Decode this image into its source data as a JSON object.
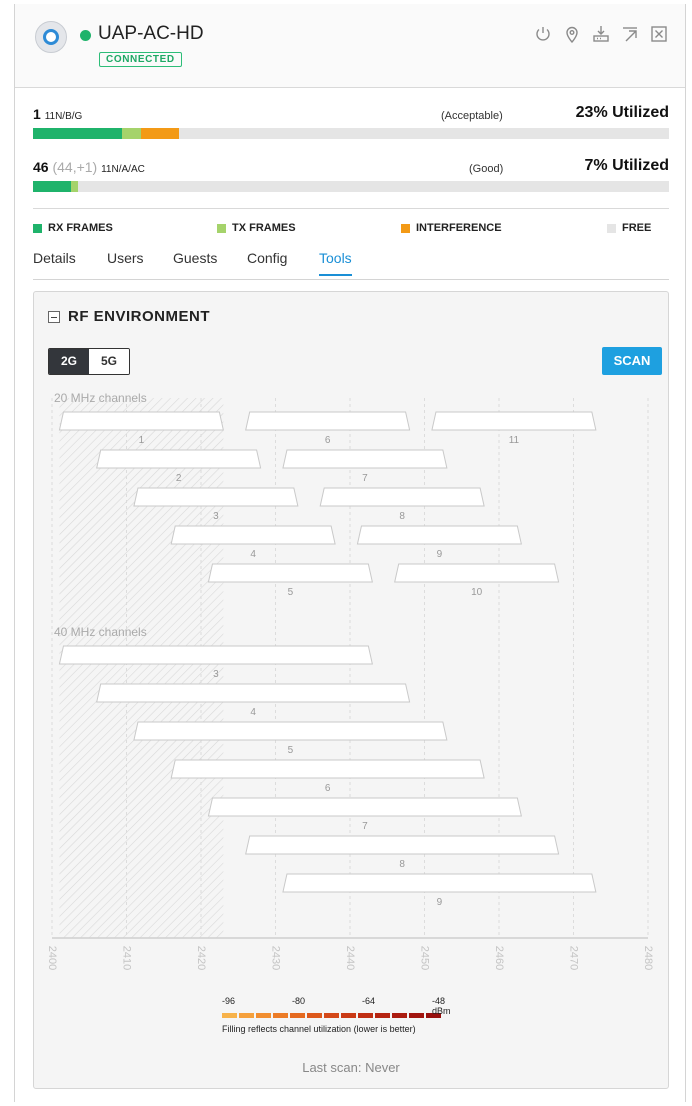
{
  "device": {
    "name": "UAP-AC-HD",
    "status": "CONNECTED",
    "status_color": "#1fb36b",
    "header_icons": [
      "power-icon",
      "locate-icon",
      "upgrade-icon",
      "popout-icon",
      "close-icon"
    ]
  },
  "radios": [
    {
      "channel": "1",
      "extra": "",
      "standard": "11N/B/G",
      "rating": "(Acceptable)",
      "utilization": "23% Utilized",
      "bar": {
        "rx": 0.14,
        "tx": 0.03,
        "interference": 0.06
      }
    },
    {
      "channel": "46",
      "extra": "(44,+1)",
      "standard": "11N/A/AC",
      "rating": "(Good)",
      "utilization": "7% Utilized",
      "bar": {
        "rx": 0.06,
        "tx": 0.01,
        "interference": 0.0
      }
    }
  ],
  "legend": [
    {
      "label": "RX FRAMES",
      "color": "#1fb36b"
    },
    {
      "label": "TX FRAMES",
      "color": "#a5d36b"
    },
    {
      "label": "INTERFERENCE",
      "color": "#f39a16"
    },
    {
      "label": "FREE",
      "color": "#e5e5e5"
    }
  ],
  "tabs": [
    "Details",
    "Users",
    "Guests",
    "Config",
    "Tools"
  ],
  "active_tab": "Tools",
  "rf": {
    "title": "RF ENVIRONMENT",
    "bands": [
      "2G",
      "5G"
    ],
    "active_band": "2G",
    "scan_label": "SCAN",
    "last_scan": "Last scan: Never",
    "scale_labels": [
      "-96",
      "-80",
      "-64",
      "-48 dBm"
    ],
    "scale_colors": [
      "#f7b24a",
      "#f5a03c",
      "#f18e30",
      "#ec7c27",
      "#e56a20",
      "#dd581b",
      "#d44818",
      "#ca3a15",
      "#c02e13",
      "#b62411",
      "#ac1c10",
      "#a2150f",
      "#98100e"
    ],
    "scale_note": "Filling reflects channel utilization (lower is better)"
  },
  "chart_data": {
    "type": "bar",
    "x_ticks": [
      2400,
      2410,
      2420,
      2430,
      2440,
      2450,
      2460,
      2470,
      2480
    ],
    "xlim": [
      2400,
      2480
    ],
    "highlight_range": [
      2401,
      2423
    ],
    "sections": [
      {
        "label": "20 MHz channels",
        "channels": [
          {
            "channel": "1",
            "start": 2401,
            "end": 2423
          },
          {
            "channel": "2",
            "start": 2406,
            "end": 2428
          },
          {
            "channel": "3",
            "start": 2411,
            "end": 2433
          },
          {
            "channel": "4",
            "start": 2416,
            "end": 2438
          },
          {
            "channel": "5",
            "start": 2421,
            "end": 2443
          },
          {
            "channel": "6",
            "start": 2426,
            "end": 2448
          },
          {
            "channel": "7",
            "start": 2431,
            "end": 2453
          },
          {
            "channel": "8",
            "start": 2436,
            "end": 2458
          },
          {
            "channel": "9",
            "start": 2441,
            "end": 2463
          },
          {
            "channel": "10",
            "start": 2446,
            "end": 2468
          },
          {
            "channel": "11",
            "start": 2451,
            "end": 2473
          }
        ]
      },
      {
        "label": "40 MHz channels",
        "channels": [
          {
            "channel": "3",
            "start": 2401,
            "end": 2443
          },
          {
            "channel": "4",
            "start": 2406,
            "end": 2448
          },
          {
            "channel": "5",
            "start": 2411,
            "end": 2453
          },
          {
            "channel": "6",
            "start": 2416,
            "end": 2458
          },
          {
            "channel": "7",
            "start": 2421,
            "end": 2463
          },
          {
            "channel": "8",
            "start": 2426,
            "end": 2468
          },
          {
            "channel": "9",
            "start": 2431,
            "end": 2473
          }
        ]
      }
    ]
  }
}
